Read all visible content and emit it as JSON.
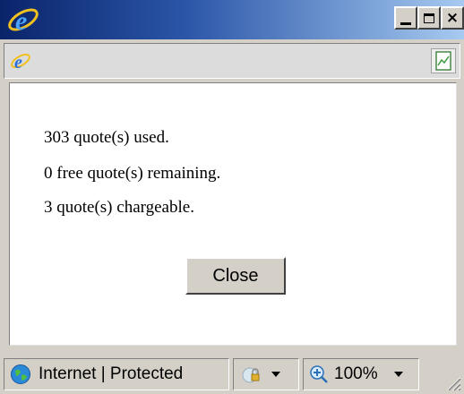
{
  "titlebar": {
    "icon": "internet-explorer-icon",
    "buttons": {
      "minimize": "_",
      "maximize": "",
      "close": "×"
    },
    "gradient_start": "#0a246a",
    "gradient_end": "#a6caf0"
  },
  "addressbar": {
    "left_icon": "internet-explorer-icon",
    "right_icon": "page-icon"
  },
  "content": {
    "messages": [
      "303 quote(s) used.",
      "0 free quote(s) remaining.",
      "3 quote(s) chargeable."
    ],
    "close_label": "Close"
  },
  "statusbar": {
    "zone_icon": "globe-icon",
    "zone_text": "Internet | Protected",
    "lock_icon": "lock-icon",
    "zoom_icon": "zoom-icon",
    "zoom_text": "100%"
  }
}
